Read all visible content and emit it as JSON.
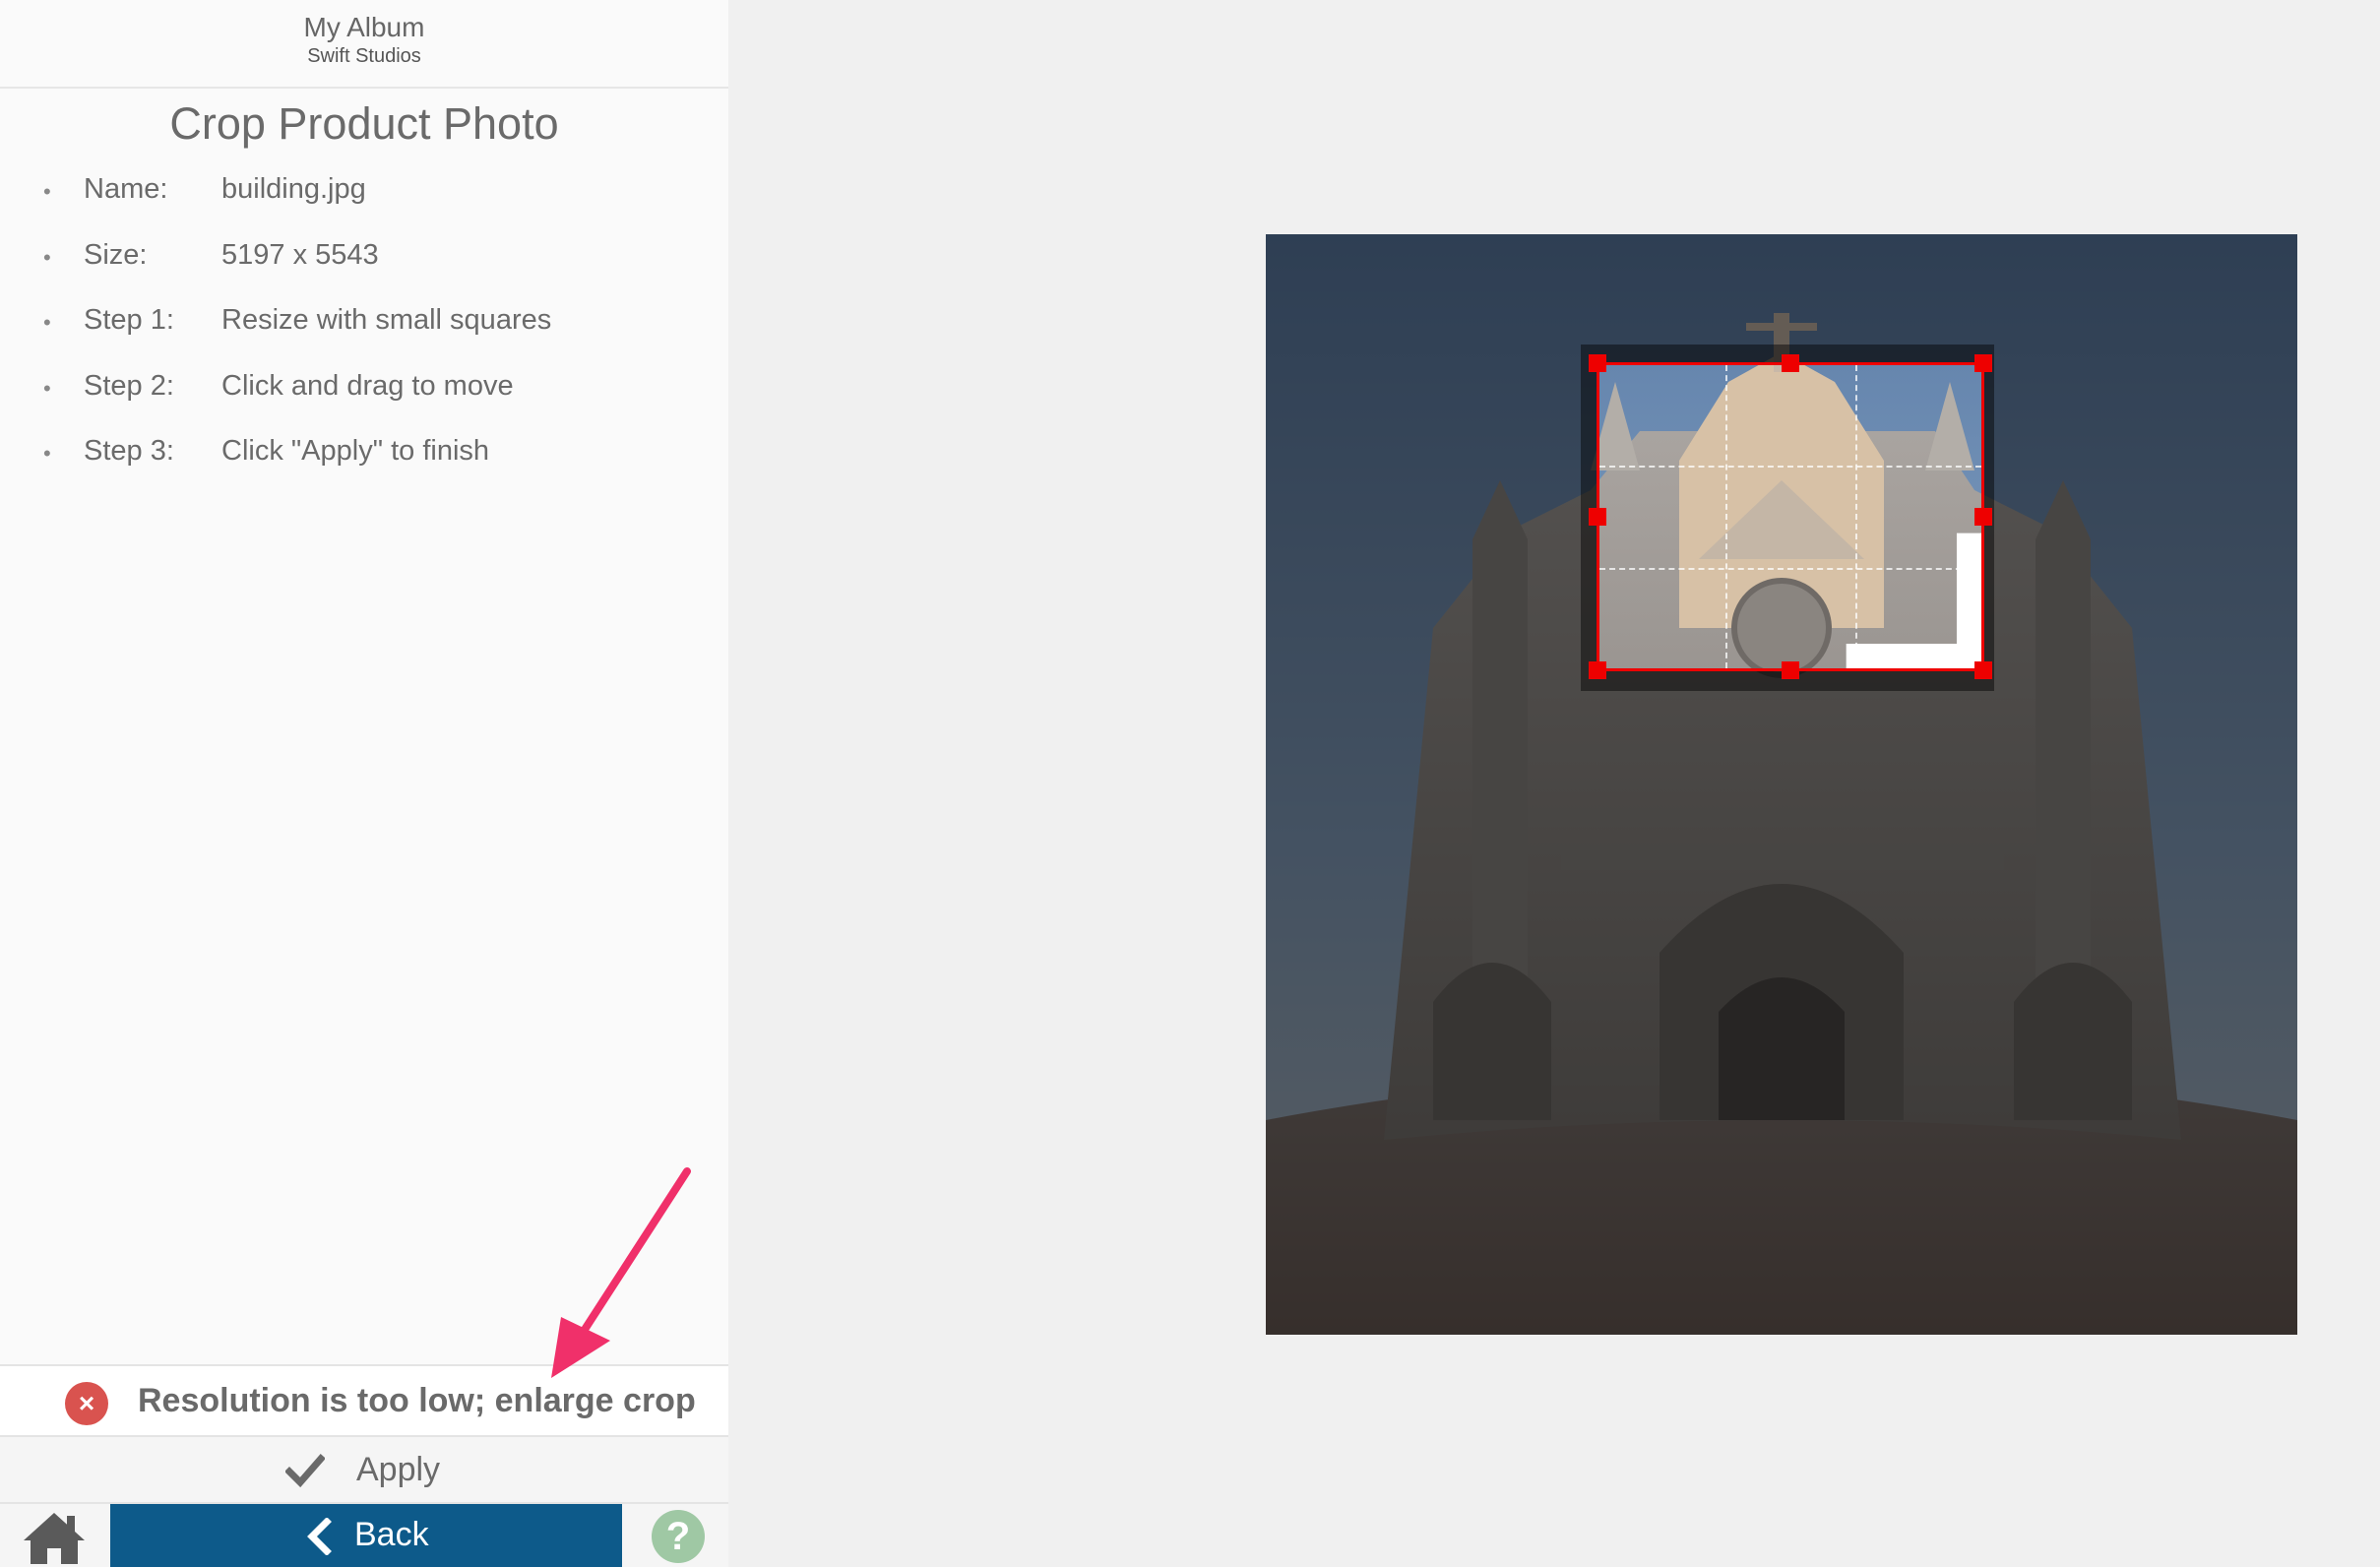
{
  "album": {
    "title": "My Album",
    "subtitle": "Swift Studios"
  },
  "panel": {
    "title": "Crop Product Photo",
    "info": [
      {
        "key": "Name:",
        "value": "building.jpg"
      },
      {
        "key": "Size:",
        "value": "5197 x 5543"
      },
      {
        "key": "Step 1:",
        "value": "Resize with small squares"
      },
      {
        "key": "Step 2:",
        "value": "Click and drag to move"
      },
      {
        "key": "Step 3:",
        "value": "Click \"Apply\" to finish"
      }
    ]
  },
  "status": {
    "error_message": "Resolution is too low; enlarge crop",
    "error_color": "#d9534f"
  },
  "actions": {
    "apply_label": "Apply",
    "back_label": "Back",
    "help_label": "?"
  },
  "colors": {
    "accent": "#0d5a8a",
    "crop_border": "#e00000",
    "help": "#9fc8a4",
    "annotation_arrow": "#f0306a"
  },
  "icons": {
    "error": "error-circle-x-icon",
    "apply": "checkmark-icon",
    "home": "home-icon",
    "back": "chevron-left-icon",
    "help": "question-circle-icon"
  }
}
